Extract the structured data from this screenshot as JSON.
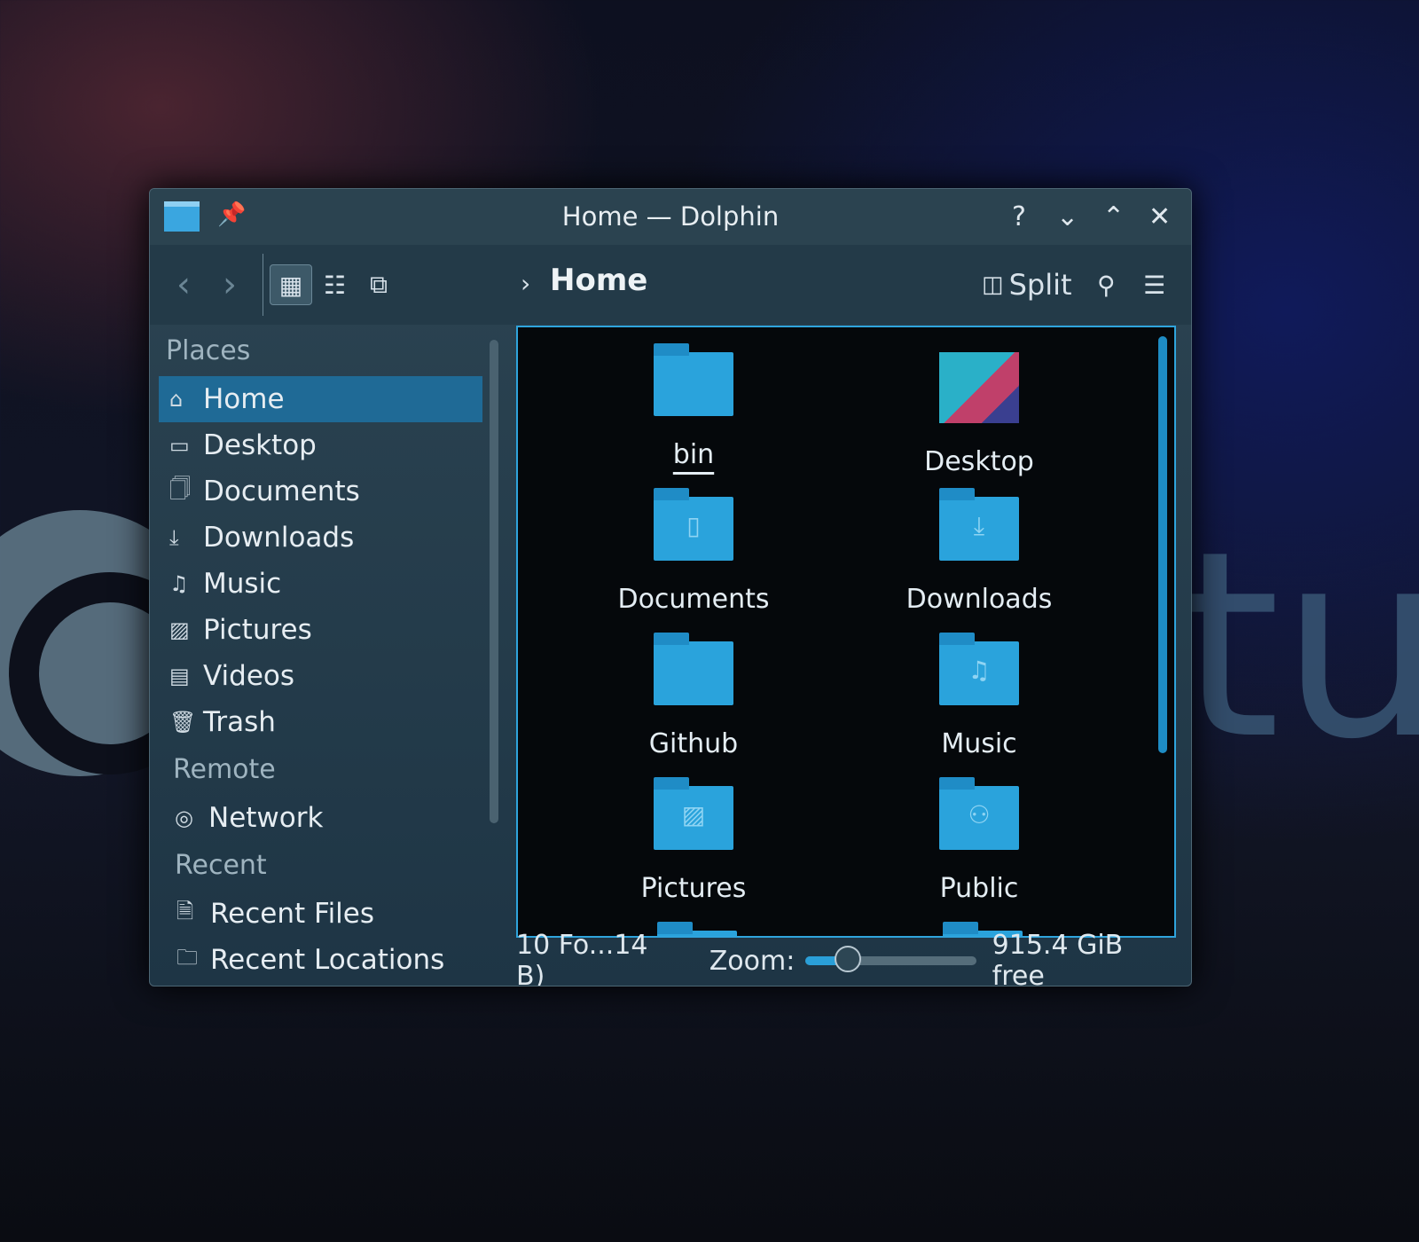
{
  "window": {
    "title": "Home — Dolphin"
  },
  "titlebar": {
    "help": "?",
    "minimize": "⌄",
    "maximize": "⌃",
    "close": "✕"
  },
  "toolbar": {
    "back": "‹",
    "forward": "›",
    "breadcrumb_sep": "›",
    "breadcrumb": "Home",
    "split_label": "Split"
  },
  "sidebar": {
    "places_header": "Places",
    "places": [
      {
        "label": "Home",
        "icon": "⌂"
      },
      {
        "label": "Desktop",
        "icon": "▭"
      },
      {
        "label": "Documents",
        "icon": "🗍"
      },
      {
        "label": "Downloads",
        "icon": "⤓"
      },
      {
        "label": "Music",
        "icon": "♫"
      },
      {
        "label": "Pictures",
        "icon": "▨"
      },
      {
        "label": "Videos",
        "icon": "▤"
      },
      {
        "label": "Trash",
        "icon": "🗑"
      }
    ],
    "remote_header": "Remote",
    "remote": [
      {
        "label": "Network",
        "icon": "◎"
      }
    ],
    "recent_header": "Recent",
    "recent": [
      {
        "label": "Recent Files",
        "icon": "🗎"
      },
      {
        "label": "Recent Locations",
        "icon": "🗀"
      }
    ]
  },
  "files": [
    {
      "name": "bin",
      "glyph": ""
    },
    {
      "name": "Desktop",
      "glyph": ""
    },
    {
      "name": "Documents",
      "glyph": "▯"
    },
    {
      "name": "Downloads",
      "glyph": "⤓"
    },
    {
      "name": "Github",
      "glyph": ""
    },
    {
      "name": "Music",
      "glyph": "♫"
    },
    {
      "name": "Pictures",
      "glyph": "▨"
    },
    {
      "name": "Public",
      "glyph": "⚇"
    }
  ],
  "status": {
    "summary": "10 Fo...14 B)",
    "zoom_label": "Zoom:",
    "zoom_value": 0.25,
    "free_space": "915.4 GiB free"
  },
  "background": {
    "text": "tu"
  }
}
